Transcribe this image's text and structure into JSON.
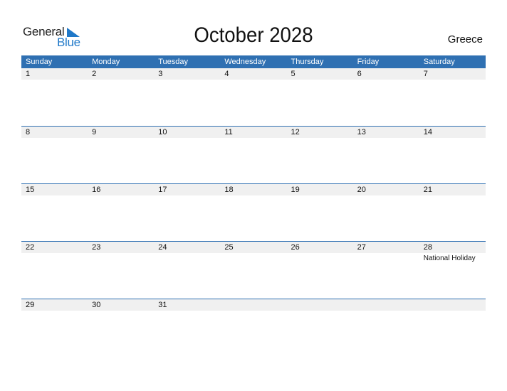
{
  "logo": {
    "general": "General",
    "blue": "Blue",
    "brand_color": "#1f78c8"
  },
  "title": "October 2028",
  "country": "Greece",
  "header_color": "#2f70b2",
  "weekdays": [
    "Sunday",
    "Monday",
    "Tuesday",
    "Wednesday",
    "Thursday",
    "Friday",
    "Saturday"
  ],
  "weeks": [
    {
      "days": [
        "1",
        "2",
        "3",
        "4",
        "5",
        "6",
        "7"
      ],
      "events": [
        "",
        "",
        "",
        "",
        "",
        "",
        ""
      ]
    },
    {
      "days": [
        "8",
        "9",
        "10",
        "11",
        "12",
        "13",
        "14"
      ],
      "events": [
        "",
        "",
        "",
        "",
        "",
        "",
        ""
      ]
    },
    {
      "days": [
        "15",
        "16",
        "17",
        "18",
        "19",
        "20",
        "21"
      ],
      "events": [
        "",
        "",
        "",
        "",
        "",
        "",
        ""
      ]
    },
    {
      "days": [
        "22",
        "23",
        "24",
        "25",
        "26",
        "27",
        "28"
      ],
      "events": [
        "",
        "",
        "",
        "",
        "",
        "",
        "National Holiday"
      ]
    },
    {
      "days": [
        "29",
        "30",
        "31",
        "",
        "",
        "",
        ""
      ],
      "events": [
        "",
        "",
        "",
        "",
        "",
        "",
        ""
      ]
    }
  ]
}
